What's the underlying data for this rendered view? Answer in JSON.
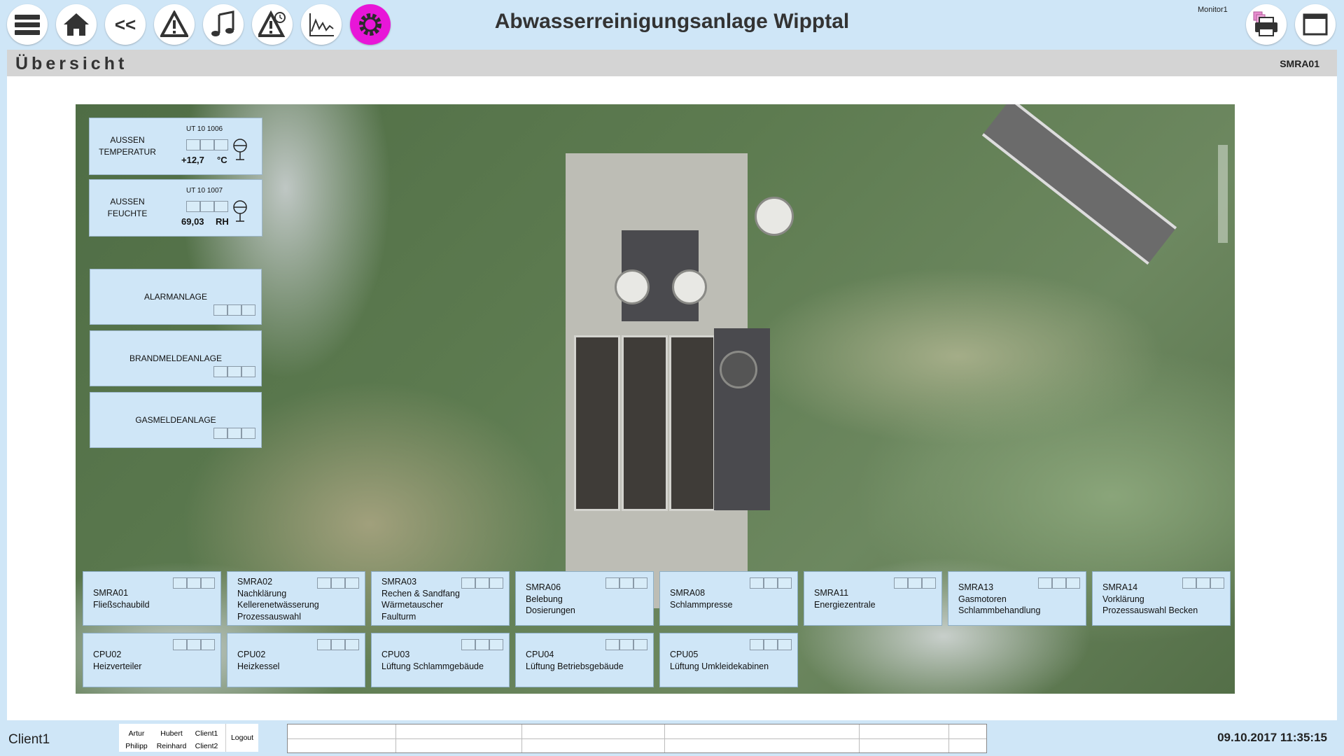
{
  "header": {
    "title": "Abwasserreinigungsanlage Wipptal",
    "monitor": "Monitor1",
    "buttons": [
      "menu-icon",
      "home-icon",
      "back-icon",
      "alarm-icon",
      "sound-icon",
      "alarm-history-icon",
      "trend-icon",
      "settings-icon"
    ],
    "back_label": "<<"
  },
  "subheader": {
    "title": "Übersicht",
    "code": "SMRA01"
  },
  "info": {
    "temp": {
      "label": "AUSSEN\nTEMPERATUR",
      "tag": "UT 10 1006",
      "value": "+12,7",
      "unit": "°C"
    },
    "humidity": {
      "label": "AUSSEN\nFEUCHTE",
      "tag": "UT 10 1007",
      "value": "69,03",
      "unit": "RH"
    },
    "alarm": "ALARMANLAGE",
    "fire": "BRANDMELDEANLAGE",
    "gas": "GASMELDEANLAGE"
  },
  "tiles_row1": [
    "SMRA01\nFließschaubild",
    "SMRA02\nNachklärung\nKellerenetwässerung\nProzessauswahl",
    "SMRA03\nRechen & Sandfang\nWärmetauscher\nFaulturm",
    "SMRA06\nBelebung\nDosierungen",
    "SMRA08\nSchlammpresse",
    "SMRA11\nEnergiezentrale",
    "SMRA13\nGasmotoren\nSchlammbehandlung",
    "SMRA14\nVorklärung\nProzessauswahl Becken"
  ],
  "tiles_row2": [
    "CPU02\nHeizverteiler",
    "CPU02\nHeizkessel",
    "CPU03\nLüftung Schlammgebäude",
    "CPU04\nLüftung Betriebsgebäude",
    "CPU05\nLüftung Umkleidekabinen"
  ],
  "footer": {
    "client": "Client1",
    "users": [
      [
        "Artur",
        "Hubert",
        "Client1"
      ],
      [
        "Philipp",
        "Reinhard",
        "Client2"
      ]
    ],
    "logout": "Logout",
    "datetime": "09.10.2017 11:35:15"
  },
  "colors": {
    "panel": "#cfe6f7",
    "gear": "#e816d8",
    "bar": "#d4d4d4"
  }
}
